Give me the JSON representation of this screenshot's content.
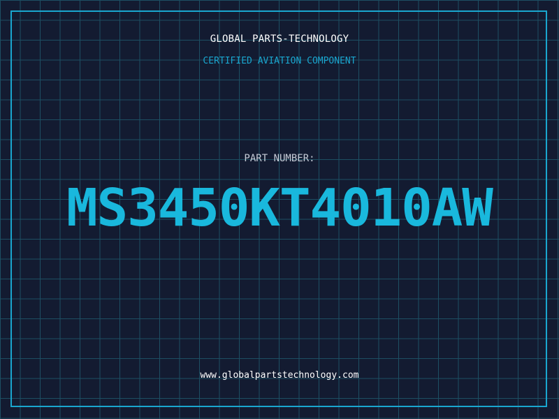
{
  "header": {
    "company": "GLOBAL PARTS-TECHNOLOGY",
    "subtitle": "CERTIFIED AVIATION COMPONENT"
  },
  "part": {
    "label": "PART NUMBER:",
    "number": "MS3450KT4010AW"
  },
  "footer": {
    "url": "www.globalpartstechnology.com"
  },
  "colors": {
    "background": "#131b31",
    "grid": "#1d4f63",
    "accent": "#1aa6cf",
    "part_number": "#19b8dd"
  }
}
